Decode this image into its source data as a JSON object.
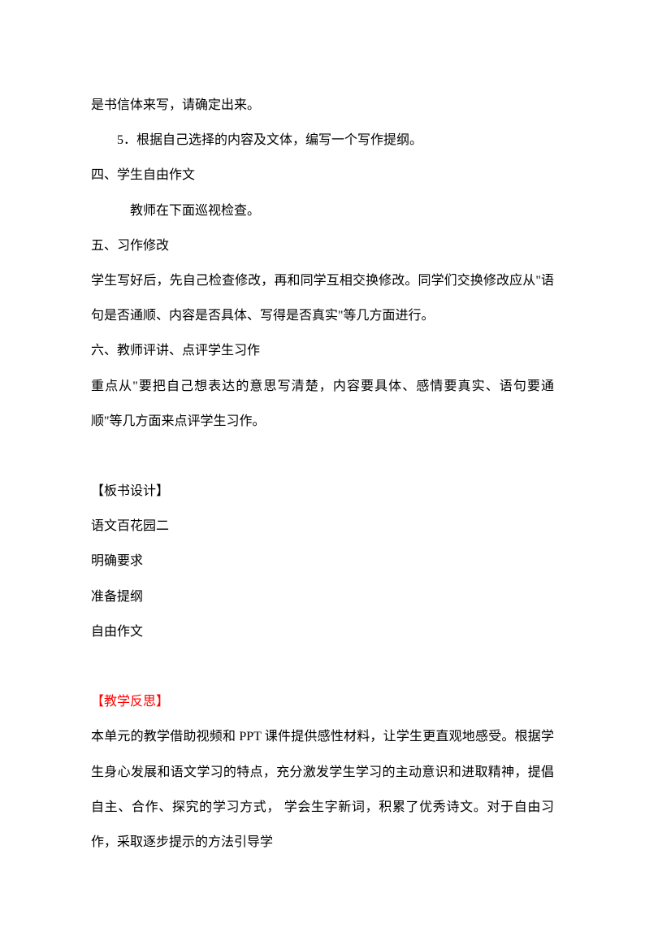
{
  "content": {
    "line1": "是书信体来写，请确定出来。",
    "line2": "5．根据自己选择的内容及文体，编写一个写作提纲。",
    "line3": "四、学生自由作文",
    "line4": "教师在下面巡视检查。",
    "line5": "五、习作修改",
    "line6": "学生写好后，先自己检查修改，再和同学互相交换修改。同学们交换修改应从\"语句是否通顺、内容是否具体、写得是否真实\"等几方面进行。",
    "line7": "六、教师评讲、点评学生习作",
    "line8": "重点从\"要把自己想表达的意思写清楚，内容要具体、感情要真实、语句要通顺\"等几方面来点评学生习作。",
    "line9": "",
    "line10": "【板书设计】",
    "line11": "语文百花园二",
    "line12": "明确要求",
    "line13": "准备提纲",
    "line14": "自由作文",
    "line15": "",
    "line16": "【教学反思】",
    "line17": "本单元的教学借助视频和 PPT 课件提供感性材料，让学生更直观地感受。根据学生身心发展和语文学习的特点，充分激发学生学习的主动意识和进取精神，提倡自主、合作、探究的学习方式， 学会生字新词，积累了优秀诗文。对于自由习作，采取逐步提示的方法引导学"
  }
}
